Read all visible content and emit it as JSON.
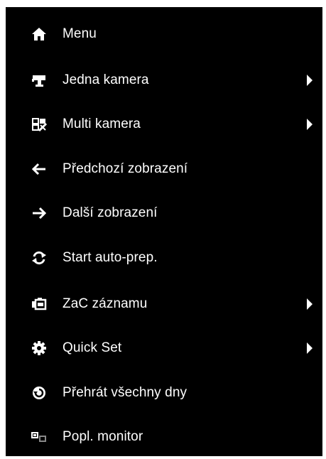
{
  "menu": {
    "items": [
      {
        "label": "Menu",
        "icon": "home-icon",
        "submenu": false
      },
      {
        "label": "Jedna kamera",
        "icon": "camera-icon",
        "submenu": true
      },
      {
        "label": "Multi kamera",
        "icon": "multi-camera-icon",
        "submenu": true
      },
      {
        "label": "Předchozí zobrazení",
        "icon": "arrow-left-icon",
        "submenu": false
      },
      {
        "label": "Další zobrazení",
        "icon": "arrow-right-icon",
        "submenu": false
      },
      {
        "label": "Start auto-prep.",
        "icon": "refresh-icon",
        "submenu": false
      },
      {
        "label": "ZaC záznamu",
        "icon": "record-camera-icon",
        "submenu": true
      },
      {
        "label": "Quick Set",
        "icon": "gear-icon",
        "submenu": true
      },
      {
        "label": "Přehrát všechny dny",
        "icon": "playback-icon",
        "submenu": false
      },
      {
        "label": "Popl. monitor",
        "icon": "monitor-switch-icon",
        "submenu": false
      }
    ]
  },
  "colors": {
    "background": "#000000",
    "text": "#ffffff",
    "page": "#ffffff"
  }
}
